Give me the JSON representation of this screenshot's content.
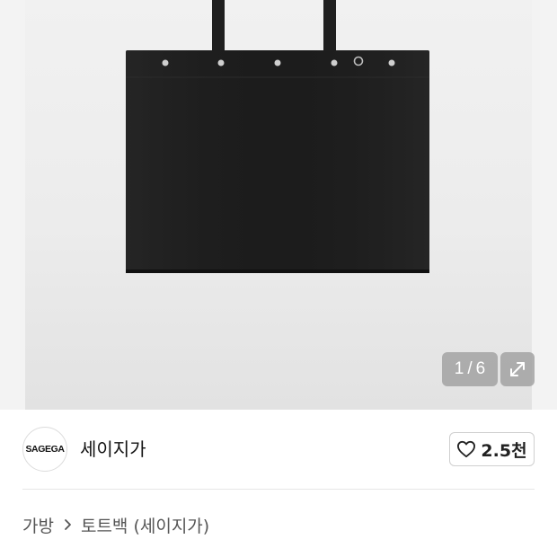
{
  "gallery": {
    "current": "1",
    "separator": "/",
    "total": "6",
    "expand_icon": "expand-arrows-icon",
    "image_description_icon": "tote-bag-image"
  },
  "seller": {
    "logo_text": "SAGEGA",
    "name": "세이지가"
  },
  "like": {
    "icon": "heart-outline-icon",
    "count": "2.5천"
  },
  "breadcrumb": {
    "category": "가방",
    "subcategory": "토트백 (세이지가)",
    "chevron_icon": "chevron-right-icon"
  },
  "colors": {
    "bag": "#1e1e1e",
    "badge_bg": "#a0a0a0",
    "text_primary": "#111111",
    "text_secondary": "#555555"
  }
}
